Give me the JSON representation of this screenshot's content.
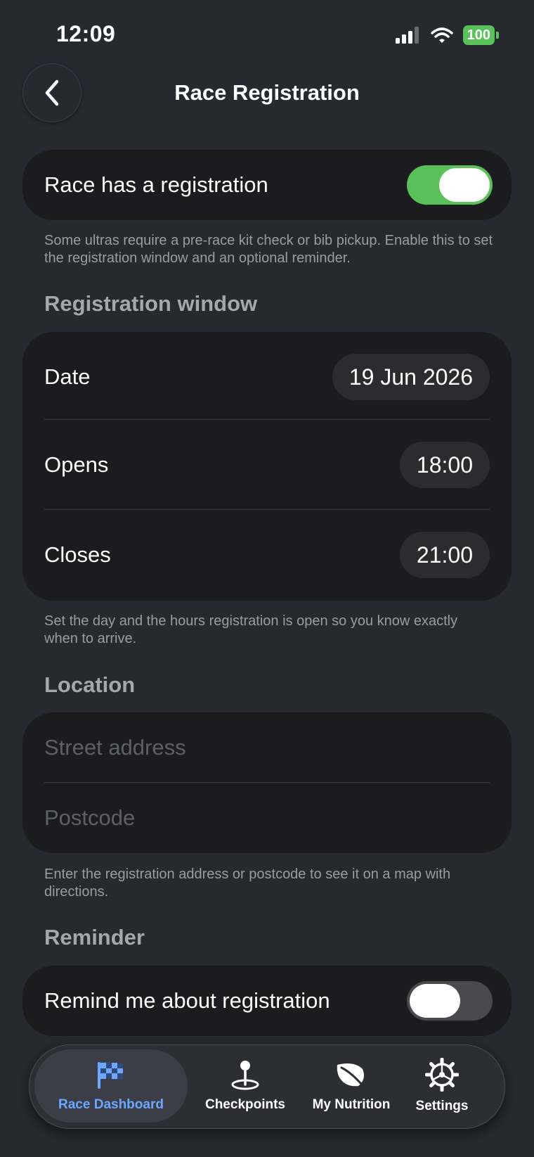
{
  "status_bar": {
    "time": "12:09",
    "battery": "100"
  },
  "header": {
    "title": "Race Registration"
  },
  "registration_toggle": {
    "label": "Race has a registration",
    "enabled": true,
    "footnote": "Some ultras require a pre-race kit check or bib pickup. Enable this to set the registration window and an optional reminder."
  },
  "registration_window": {
    "header": "Registration window",
    "rows": [
      {
        "label": "Date",
        "value": "19 Jun 2026"
      },
      {
        "label": "Opens",
        "value": "18:00"
      },
      {
        "label": "Closes",
        "value": "21:00"
      }
    ],
    "footnote": "Set the day and the hours registration is open so you know exactly when to arrive."
  },
  "location": {
    "header": "Location",
    "street_placeholder": "Street address",
    "street_value": "",
    "postcode_placeholder": "Postcode",
    "postcode_value": "",
    "footnote": "Enter the registration address or postcode to see it on a map with directions."
  },
  "reminder": {
    "header": "Reminder",
    "label": "Remind me about registration",
    "enabled": false
  },
  "tab_bar": {
    "active": "race_dashboard",
    "tabs": [
      {
        "id": "race_dashboard",
        "label": "Race Dashboard",
        "icon": "checkered-flag-icon"
      },
      {
        "id": "checkpoints",
        "label": "Checkpoints",
        "icon": "map-pin-icon"
      },
      {
        "id": "my_nutrition",
        "label": "My Nutrition",
        "icon": "leaf-icon"
      },
      {
        "id": "settings",
        "label": "Settings",
        "icon": "gear-icon"
      }
    ]
  },
  "colors": {
    "background": "#262930",
    "card": "#1c1c1e",
    "toggle_on": "#5ac15a",
    "accent": "#6da7ff",
    "battery": "#5ac25a"
  }
}
